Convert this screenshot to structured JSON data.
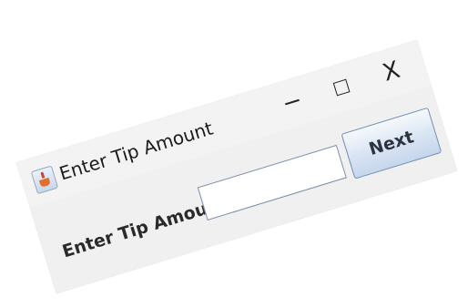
{
  "window": {
    "title": "Enter Tip Amount",
    "icon": "java-cup-icon",
    "controls": {
      "minimize": "minimize-icon",
      "maximize": "maximize-icon",
      "close": "close-icon",
      "close_glyph": "X"
    }
  },
  "form": {
    "label": "Enter Tip Amount:",
    "input_value": "",
    "input_placeholder": "",
    "next_label": "Next"
  },
  "colors": {
    "window_bg": "#f0f0f0",
    "button_border": "#6f8fb6",
    "input_border": "#7a8ea8"
  }
}
